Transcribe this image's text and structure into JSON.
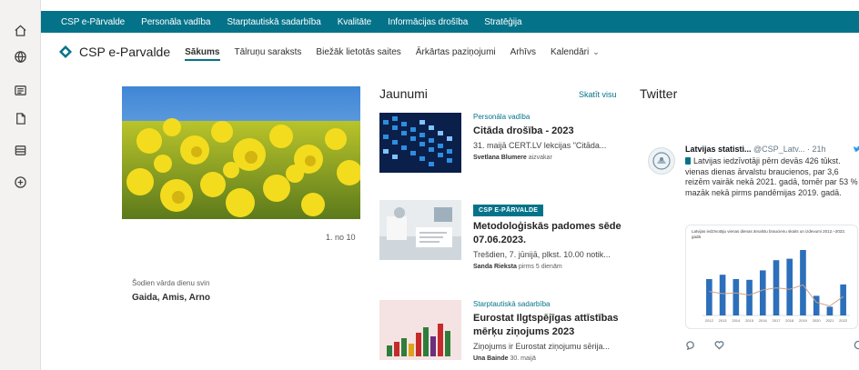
{
  "rail": {
    "icons": [
      "home-icon",
      "globe-icon",
      "news-icon",
      "file-icon",
      "list-icon",
      "create-icon"
    ]
  },
  "hubbar": {
    "links": [
      "CSP e-Pārvalde",
      "Personāla vadība",
      "Starptautiskā sadarbība",
      "Kvalitāte",
      "Informācijas drošība",
      "Stratēģija"
    ]
  },
  "site": {
    "title": "CSP e-Parvalde",
    "nav": [
      {
        "label": "Sākums",
        "active": true
      },
      {
        "label": "Tālruņu saraksts"
      },
      {
        "label": "Biežāk lietotās saites"
      },
      {
        "label": "Ārkārtas paziņojumi"
      },
      {
        "label": "Arhīvs"
      },
      {
        "label": "Kalendāri"
      }
    ]
  },
  "hero": {
    "counter": "1. no 10"
  },
  "birthday": {
    "label": "Šodien vārda dienu svin",
    "names": "Gaida, Amis, Arno"
  },
  "news": {
    "heading": "Jaunumi",
    "see_all": "Skatīt visu",
    "items": [
      {
        "category": "Personāla vadība",
        "title": "Citāda drošība - 2023",
        "description": "31. maijā CERT.LV lekcijas \"Citāda...",
        "author": "Svetlana Blumere",
        "meta": "aizvakar"
      },
      {
        "badge": "CSP E-PĀRVALDE",
        "title": "Metodoloģiskās padomes sēde 07.06.2023.",
        "description": "Trešdien, 7. jūnijā, plkst. 10.00 notik...",
        "author": "Sanda Rieksta",
        "meta": "pirms 5 dienām"
      },
      {
        "category": "Starptautiskā sadarbība",
        "title": "Eurostat Ilgtspējīgas attīstības mērķu ziņojums 2023",
        "description": "Ziņojums ir Eurostat ziņojumu sērija...",
        "author": "Una Bainde",
        "meta": "30. maijā"
      }
    ]
  },
  "twitter": {
    "heading": "Twitter",
    "name": "Latvijas statisti...",
    "handle": "@CSP_Latv... · 21h",
    "text": "Latvijas iedzīvotāji pērn devās 426 tūkst. vienas dienas ārvalstu braucienos, par 3,6 reizēm vairāk nekā 2021. gadā, tomēr par 53 % mazāk nekā pirms pandēmijas 2019. gadā.",
    "chart_caption": "Latvijas iedzīvotāju vienas dienas ārvalstu braucienu skaits un izdevumi 2012.–2022. gadā",
    "colors": {
      "bar": "#2c6fbb",
      "line": "#c9a28a",
      "accent": "#04738a"
    }
  },
  "chart_data": {
    "type": "bar",
    "title": "Latvijas iedzīvotāju vienas dienas ārvalstu braucienu skaits un izdevumi 2012.–2022. gadā",
    "categories": [
      "2012",
      "2013",
      "2014",
      "2015",
      "2016",
      "2017",
      "2018",
      "2019",
      "2020",
      "2021",
      "2022"
    ],
    "series": [
      {
        "values": [
          500,
          560,
          500,
          490,
          620,
          760,
          780,
          900,
          270,
          120,
          426
        ]
      },
      {
        "values": [
          330,
          300,
          310,
          280,
          350,
          380,
          360,
          420,
          180,
          130,
          260
        ]
      }
    ]
  }
}
